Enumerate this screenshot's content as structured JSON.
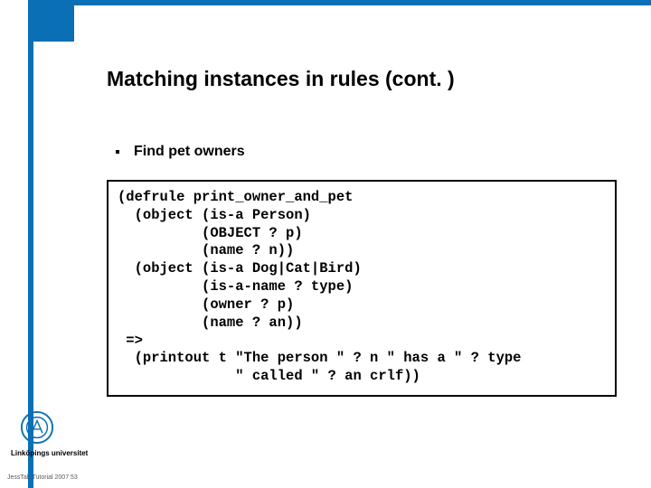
{
  "slide": {
    "title": "Matching instances in rules (cont. )",
    "bullet": "Find pet owners",
    "code": "(defrule print_owner_and_pet\n  (object (is-a Person)\n          (OBJECT ? p)\n          (name ? n))\n  (object (is-a Dog|Cat|Bird)\n          (is-a-name ? type)\n          (owner ? p)\n          (name ? an))\n =>\n  (printout t \"The person \" ? n \" has a \" ? type\n              \" called \" ? an crlf))"
  },
  "branding": {
    "university": "Linköpings universitet",
    "seal_alt": "linkoping-seal-icon"
  },
  "footer": {
    "source": "JessTab Tutorial 2007",
    "page": "53"
  }
}
